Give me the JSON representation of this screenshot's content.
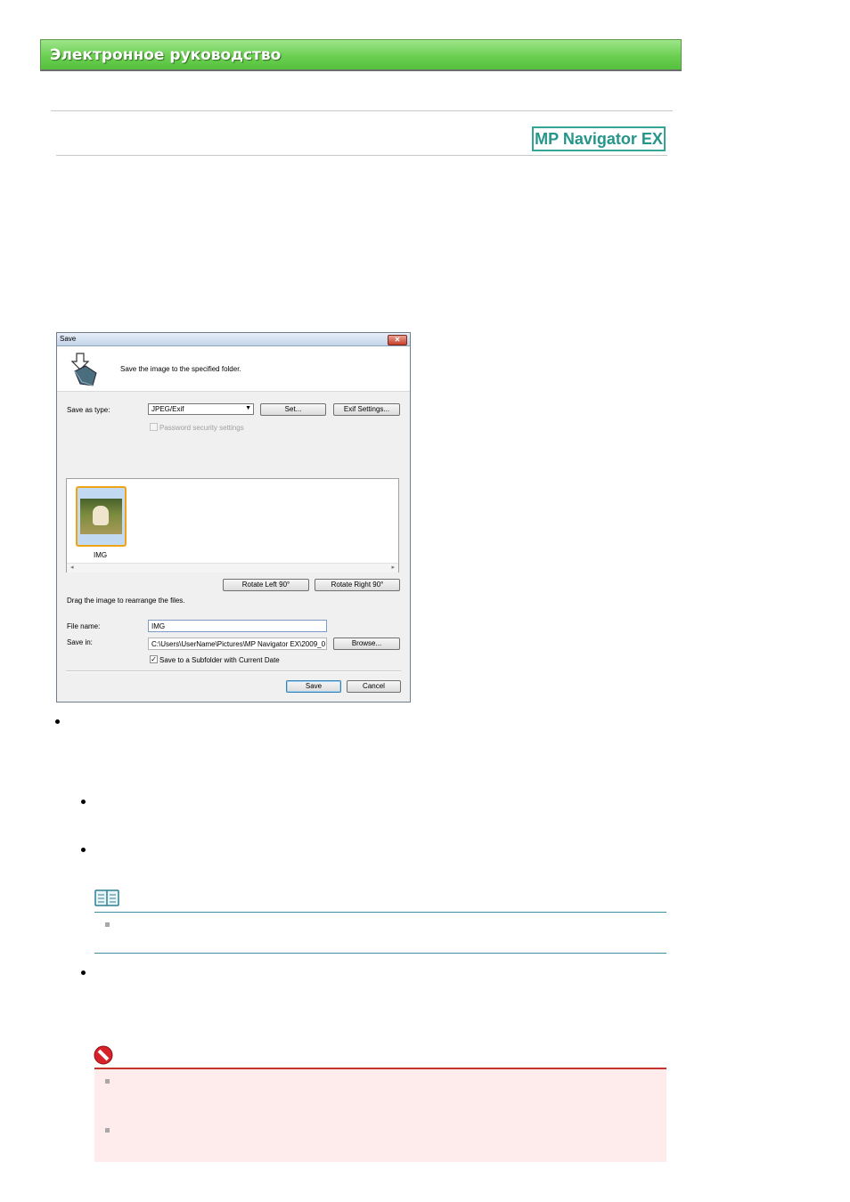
{
  "manual": {
    "banner_title": "Электронное руководство",
    "product_logo": "MP Navigator EX"
  },
  "dialog": {
    "title": "Save",
    "close_icon": "close-icon",
    "header_message": "Save the image to the specified folder.",
    "save_as_type_label": "Save as type:",
    "save_as_type_value": "JPEG/Exif",
    "set_button": "Set...",
    "exif_settings_button": "Exif Settings...",
    "password_label": "Password security settings",
    "password_checked": false,
    "password_enabled": false,
    "thumbnail_label": "IMG",
    "rotate_left_button": "Rotate Left 90°",
    "rotate_right_button": "Rotate Right 90°",
    "drag_hint": "Drag the image to rearrange the files.",
    "file_name_label": "File name:",
    "file_name_value": "IMG",
    "save_in_label": "Save in:",
    "save_in_value": "C:\\Users\\UserName\\Pictures\\MP Navigator EX\\2009_0",
    "browse_button": "Browse...",
    "subfolder_label": "Save to a Subfolder with Current Date",
    "subfolder_checked": true,
    "save_button": "Save",
    "cancel_button": "Cancel"
  },
  "icons": {
    "note": "note-book-icon",
    "important": "important-stop-icon"
  },
  "colors": {
    "banner_green": "#6bcf52",
    "logo_teal": "#26968a",
    "note_line": "#3d8fa0",
    "important_red": "#c4332c",
    "important_bg": "#fdeceb",
    "thumb_selected": "#f0a314"
  }
}
